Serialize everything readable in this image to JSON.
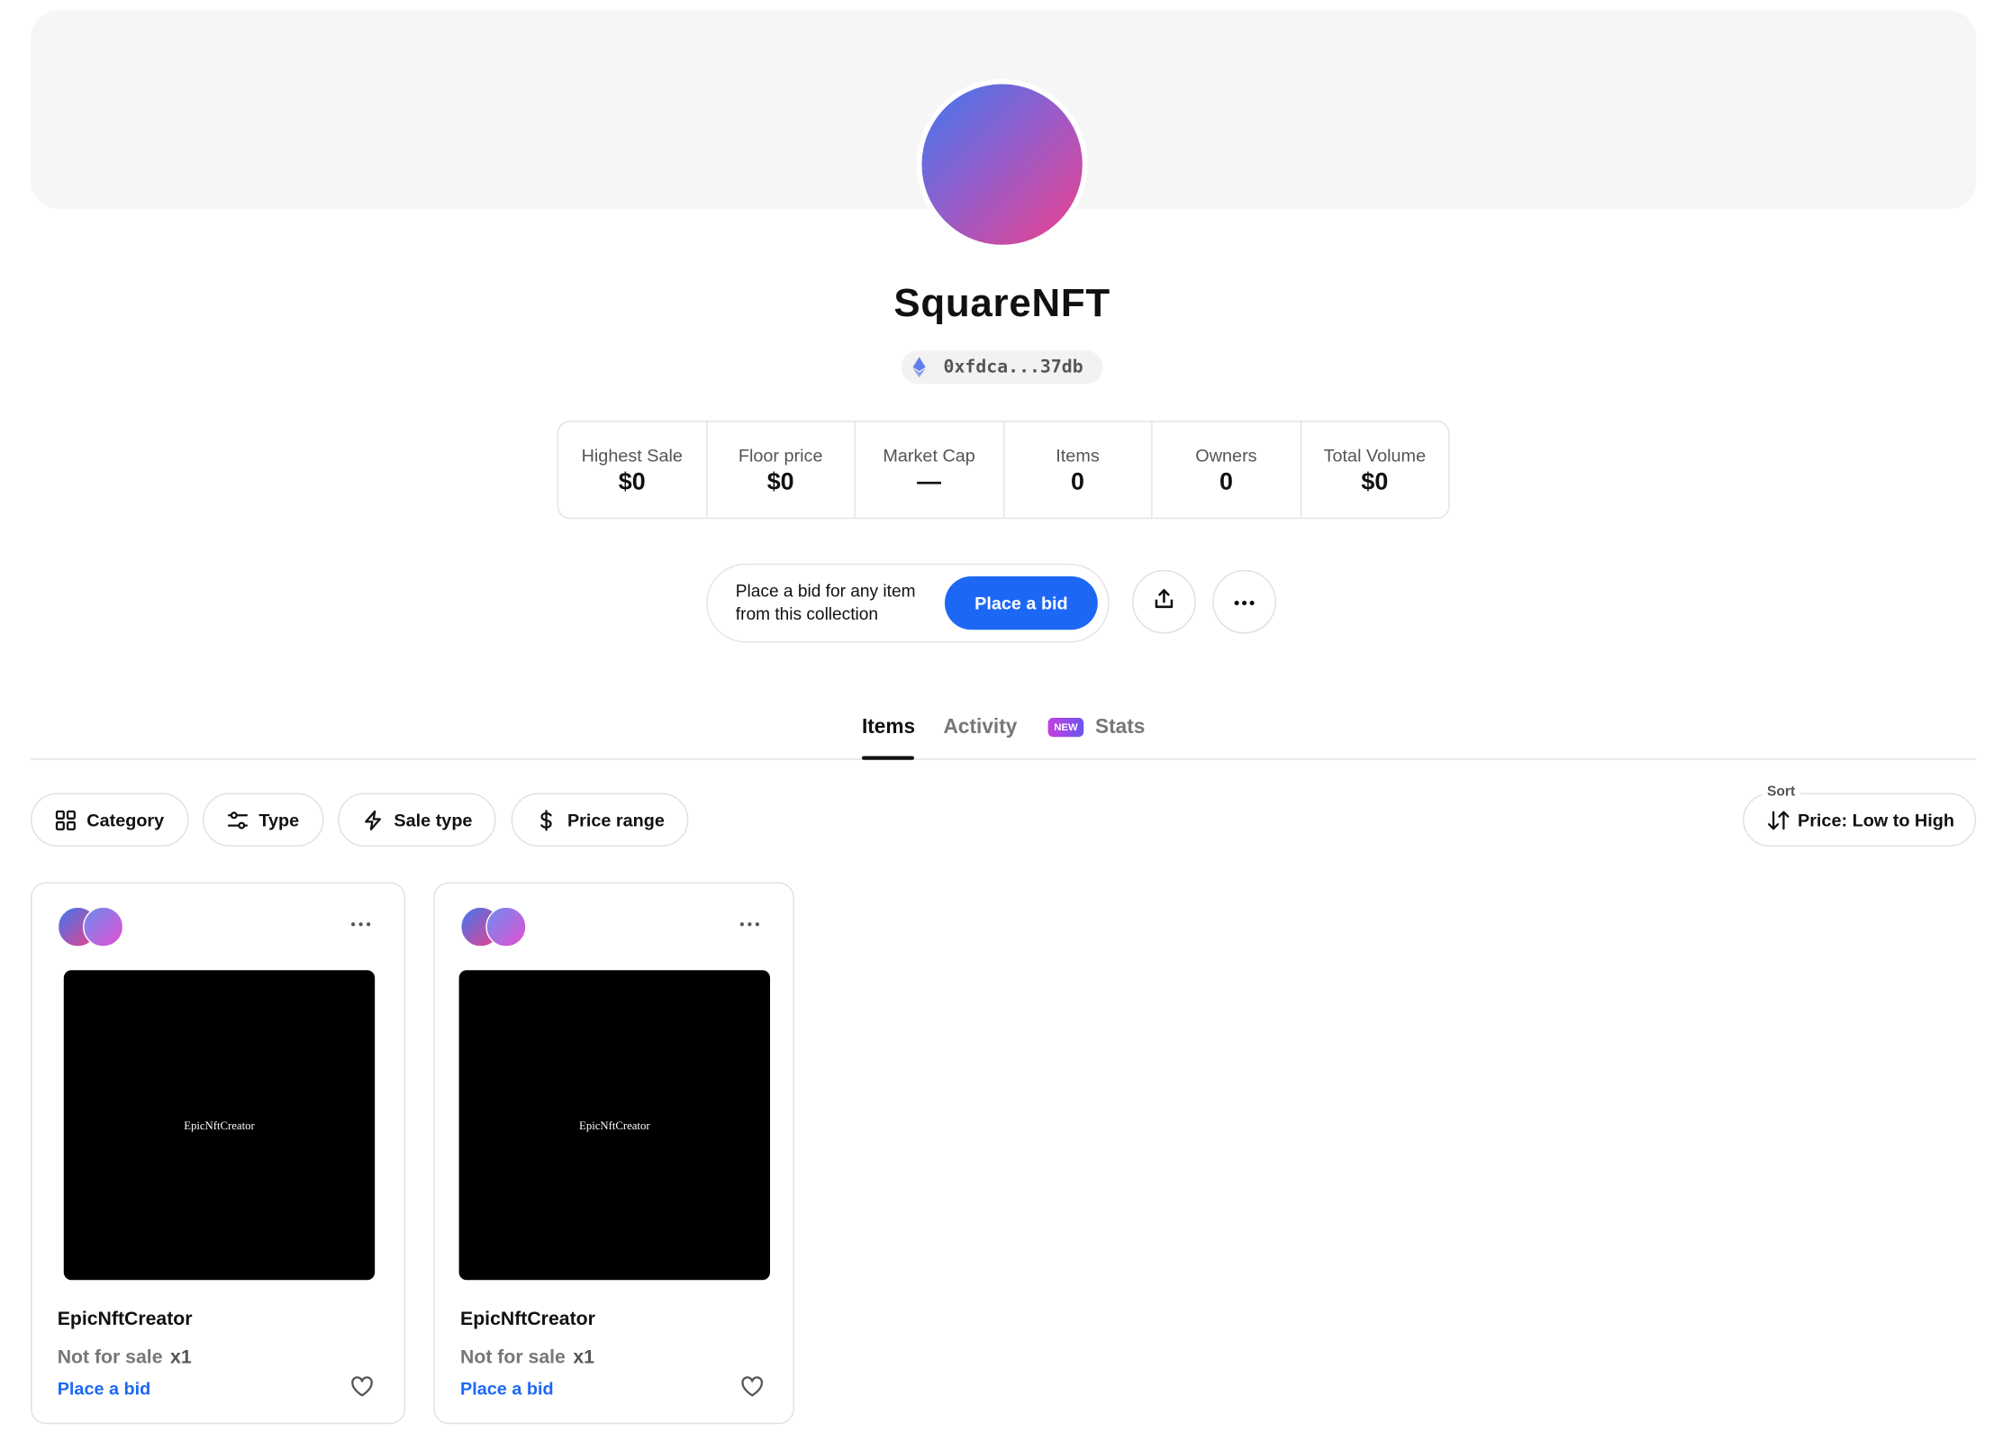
{
  "collection": {
    "name": "SquareNFT",
    "address": "0xfdca...37db"
  },
  "stats": [
    {
      "label": "Highest Sale",
      "value": "$0"
    },
    {
      "label": "Floor price",
      "value": "$0"
    },
    {
      "label": "Market Cap",
      "value": "—"
    },
    {
      "label": "Items",
      "value": "0"
    },
    {
      "label": "Owners",
      "value": "0"
    },
    {
      "label": "Total Volume",
      "value": "$0"
    }
  ],
  "bid_panel": {
    "text": "Place a bid for any item from this collection",
    "button": "Place a bid"
  },
  "tabs": {
    "items": "Items",
    "activity": "Activity",
    "new_badge": "NEW",
    "stats": "Stats"
  },
  "filters": {
    "category": "Category",
    "type": "Type",
    "sale_type": "Sale type",
    "price_range": "Price range"
  },
  "sort": {
    "label": "Sort",
    "value": "Price: Low to High"
  },
  "cards": [
    {
      "image_text": "EpicNftCreator",
      "name": "EpicNftCreator",
      "status": "Not for sale",
      "quantity": "x1",
      "action": "Place a bid"
    },
    {
      "image_text": "EpicNftCreator",
      "name": "EpicNftCreator",
      "status": "Not for sale",
      "quantity": "x1",
      "action": "Place a bid"
    }
  ],
  "colors": {
    "accent": "#1d67f5",
    "avatar_gradient": [
      "#3f78f0",
      "#ee3f8a"
    ]
  }
}
